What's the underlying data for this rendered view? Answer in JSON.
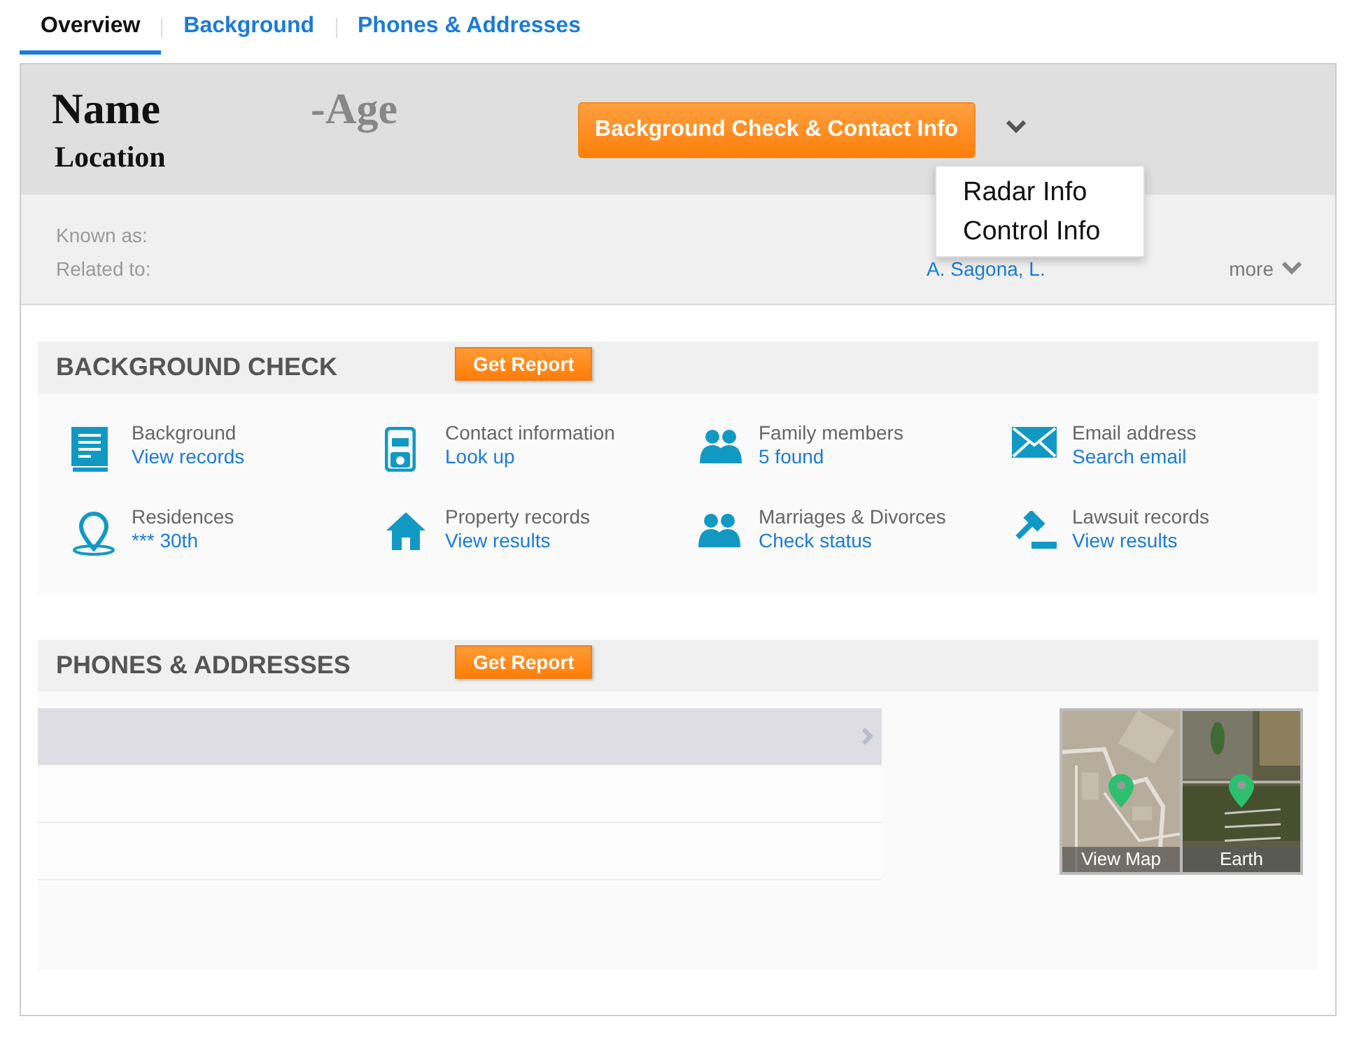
{
  "tabs": [
    {
      "label": "Overview",
      "selected": true
    },
    {
      "label": "Background",
      "selected": false
    },
    {
      "label": "Phones & Addresses",
      "selected": false
    }
  ],
  "profile": {
    "name": "Name",
    "age": "-Age",
    "location": "Location",
    "action_button": "Background Check & Contact Info",
    "menu": {
      "expanded": true,
      "items": [
        "Radar Info",
        "Control Info"
      ]
    },
    "known_as_label": "Known as:",
    "related_to_label": "Related to:",
    "related_link": "A. Sagona, L.",
    "more": "more"
  },
  "background_check": {
    "title": "BACKGROUND CHECK",
    "button": "Get Report",
    "items": [
      {
        "kind": "book",
        "title": "Background",
        "link": "View records"
      },
      {
        "kind": "phone",
        "title": "Contact information",
        "link": "Look up"
      },
      {
        "kind": "family",
        "title": "Family members",
        "link": "5 found"
      },
      {
        "kind": "email",
        "title": "Email address",
        "link": "Search email"
      },
      {
        "kind": "pin",
        "title": "Residences",
        "link": "*** 30th"
      },
      {
        "kind": "house",
        "title": "Property records",
        "link": "View results"
      },
      {
        "kind": "couple",
        "title": "Marriages & Divorces",
        "link": "Check status"
      },
      {
        "kind": "gavel",
        "title": "Lawsuit records",
        "link": "View results"
      }
    ]
  },
  "phones_addresses": {
    "title": "PHONES & ADDRESSES",
    "button": "Get Report",
    "rows": [
      {
        "selected": true
      },
      {
        "selected": false
      },
      {
        "selected": false
      }
    ],
    "maps": [
      {
        "kind": "map",
        "label": "View Map"
      },
      {
        "kind": "satellite",
        "label": "Earth"
      }
    ]
  }
}
